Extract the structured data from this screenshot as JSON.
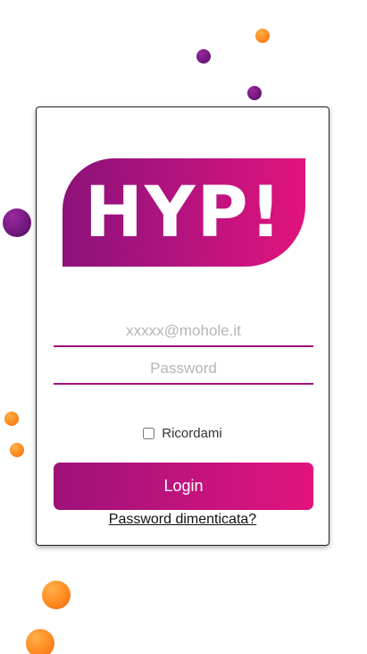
{
  "logo": {
    "text": "HYP!"
  },
  "login_form": {
    "email_placeholder": "xxxxx@mohole.it",
    "email_value": "",
    "password_placeholder": "Password",
    "password_value": "",
    "remember_label": "Ricordami",
    "remember_checked": false,
    "login_label": "Login",
    "forgot_password_label": "Password dimenticata?"
  },
  "colors": {
    "brand_gradient_start": "#8c1279",
    "brand_gradient_end": "#e2137c",
    "bubble_orange": "#ff8a1f",
    "bubble_purple": "#6f177c"
  }
}
